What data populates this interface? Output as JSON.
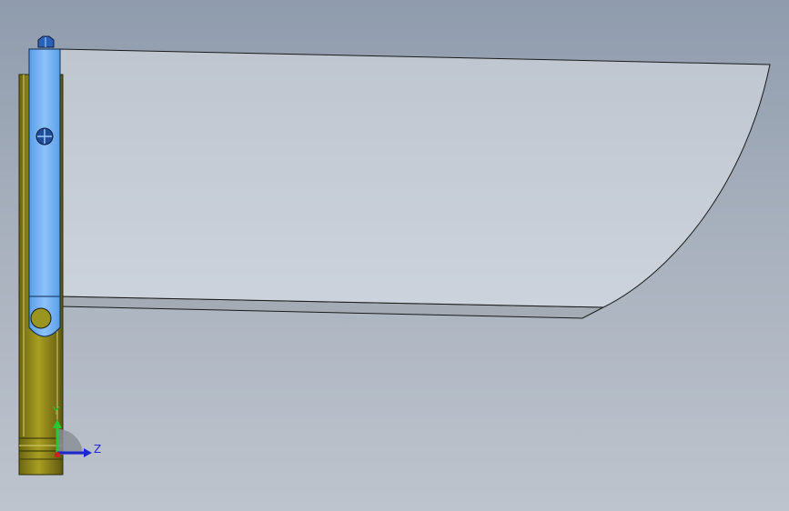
{
  "viewport": {
    "background_top": "#8f9cad",
    "background_bottom": "#bec4cd"
  },
  "model": {
    "sheet_color": "#c7cdd6",
    "frame_color": "#8c8418",
    "selected_color": "#7ab4f5"
  },
  "triad": {
    "y_label": "Y",
    "z_label": "Z",
    "y_color": "#28c832",
    "z_color": "#1e28d2",
    "x_color": "#d21e1e"
  }
}
